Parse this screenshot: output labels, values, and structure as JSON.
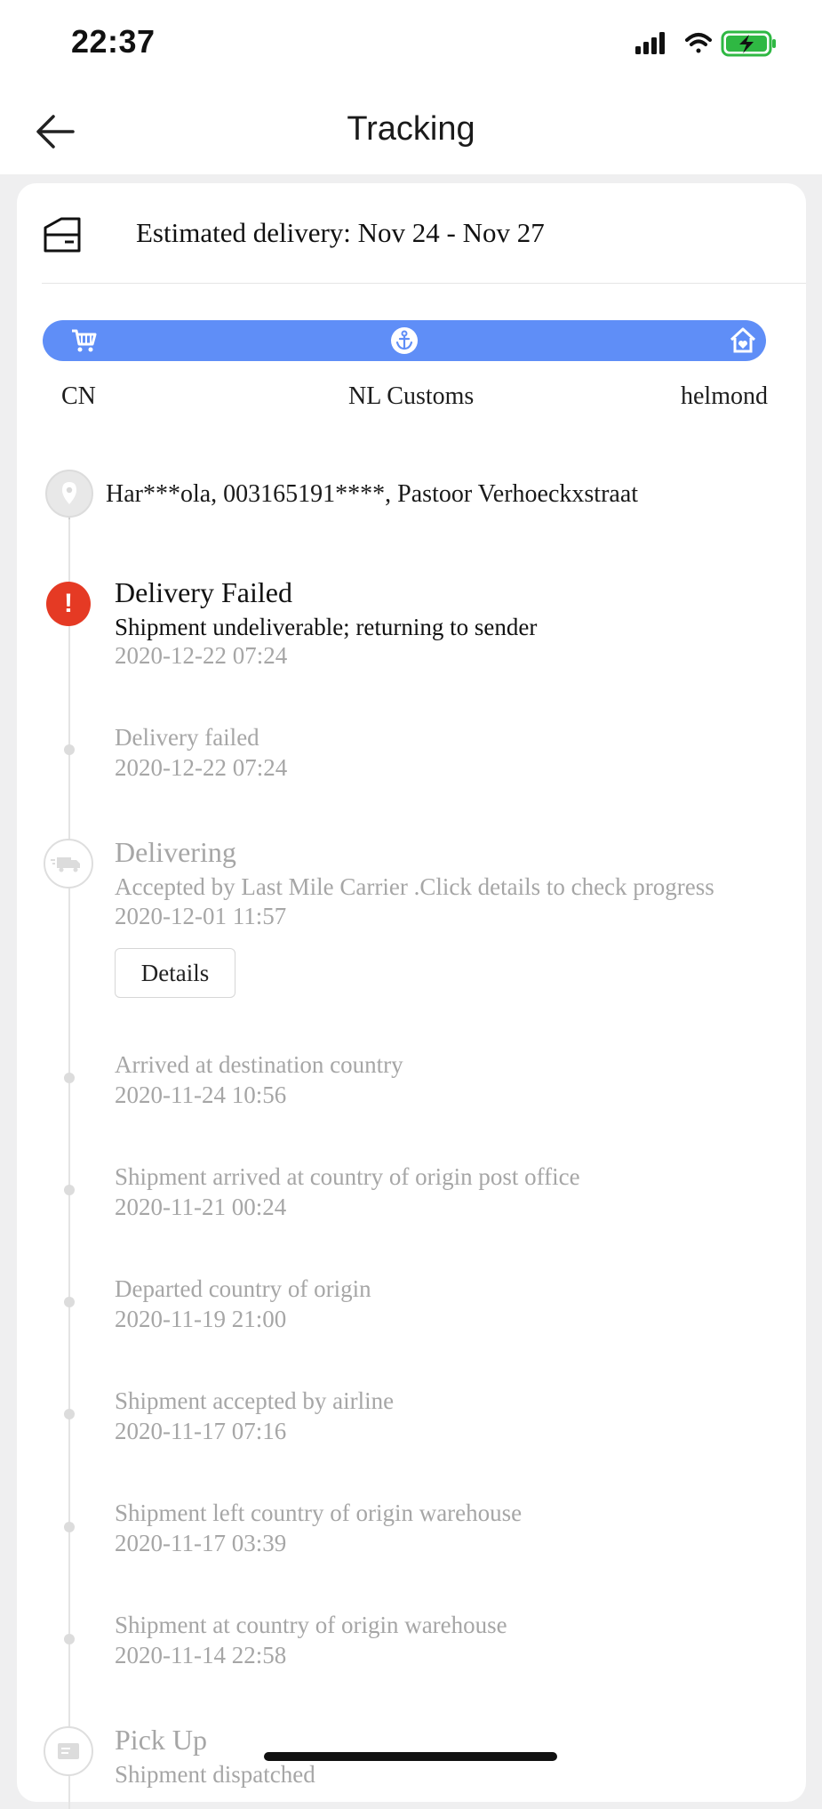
{
  "status_bar": {
    "time": "22:37"
  },
  "header": {
    "title": "Tracking"
  },
  "estimate": {
    "text": "Estimated delivery: Nov 24 - Nov 27"
  },
  "stages": [
    {
      "label": "CN",
      "icon": "cart-icon"
    },
    {
      "label": "NL Customs",
      "icon": "anchor-icon"
    },
    {
      "label": "helmond",
      "icon": "home-icon"
    }
  ],
  "address": {
    "text": "Har***ola,  003165191****,  Pastoor Verhoeckxstraat"
  },
  "events": [
    {
      "title": "Delivery Failed",
      "subtitle": "Shipment undeliverable; returning to sender",
      "time": "2020-12-22 07:24",
      "icon": "alert-icon"
    },
    {
      "title": "Delivery failed",
      "time": "2020-12-22 07:24"
    },
    {
      "title": "Delivering",
      "subtitle": "Accepted by Last Mile Carrier .Click details to check progress",
      "time": "2020-12-01 11:57",
      "icon": "truck-icon",
      "button": "Details"
    },
    {
      "title": "Arrived at destination country",
      "time": "2020-11-24 10:56"
    },
    {
      "title": "Shipment arrived at country of origin post office",
      "time": "2020-11-21 00:24"
    },
    {
      "title": "Departed country of origin",
      "time": "2020-11-19 21:00"
    },
    {
      "title": "Shipment accepted by airline",
      "time": "2020-11-17 07:16"
    },
    {
      "title": "Shipment left country of origin warehouse",
      "time": "2020-11-17 03:39"
    },
    {
      "title": "Shipment at country of origin warehouse",
      "time": "2020-11-14 22:58"
    },
    {
      "title": "Pick Up",
      "subtitle": "Shipment dispatched",
      "icon": "package-icon"
    }
  ],
  "colors": {
    "accent": "#5f8ef7",
    "alert": "#e53a24",
    "muted": "#a6a6a6"
  }
}
